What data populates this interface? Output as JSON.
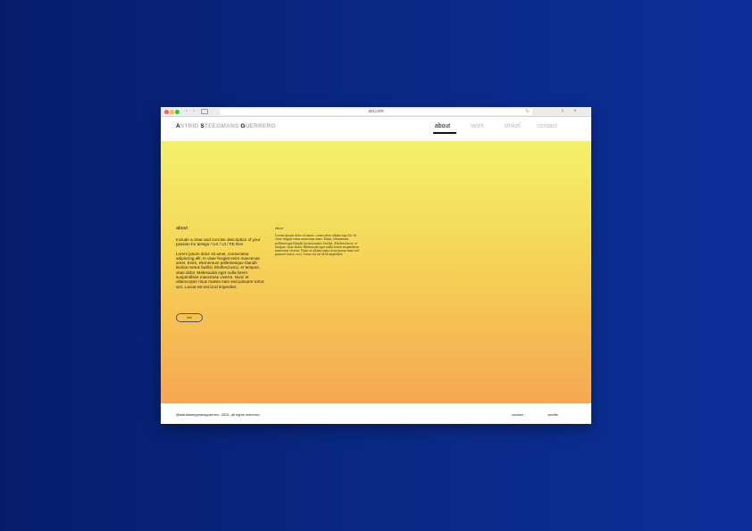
{
  "browser": {
    "url": "asl.com",
    "back": "‹",
    "forward": "›",
    "reload": "↻",
    "share": "⇪",
    "new_tab": "+"
  },
  "site": {
    "logo": {
      "a_initial": "A",
      "a_rest": "STRID ",
      "s_initial": "S",
      "s_rest": "TEEGMANS ",
      "g_initial": "G",
      "g_rest": "UERRERO"
    },
    "nav": [
      "about",
      "work",
      "strikel",
      "contact"
    ],
    "active_nav": "about"
  },
  "about": {
    "title": "about",
    "intro": "Include a clear and concise description of your passion for design / UX / UI / FE Dev",
    "body": "Lorem ipsum dolor sit amet, consectetur adipiscing elit. In vitae feugiat enim maecenas amet. Enim, elementum pellentesque blandit lacinia metus facilisi. Eleifend arcu, et tempus, vitae dolor. Malesuada eget nulla lorem suspendisse maecenas viverra. Nunc et ullamcorper risus massa nam sed posuere tortor, orci. Lacus est est id id imperdiet.",
    "button": "info"
  },
  "column2": {
    "title": "about",
    "body": "Lorem ipsum dolor sit amet, consectetur adipiscing elit. In vitae feugiat enim maecenas amet. Enim, elementum pellentesque blandit lacinia metus facilisi. Eleifend arcu, et tempus, vitae dolor. Malesuada eget nulla lorem suspendisse maecenas viverra. Nunc et ullamcorper risus massa nam sed posuere tortor, orci. Lacus est est id id imperdiet."
  },
  "footer": {
    "copyright": "@astridsteegmansguerrero, 2021, all rights reserved",
    "links": [
      "contact",
      "credits"
    ]
  },
  "colors": {
    "hero_top": "#f3f16c",
    "hero_bottom": "#f6a752",
    "background": "#0a2a88"
  }
}
